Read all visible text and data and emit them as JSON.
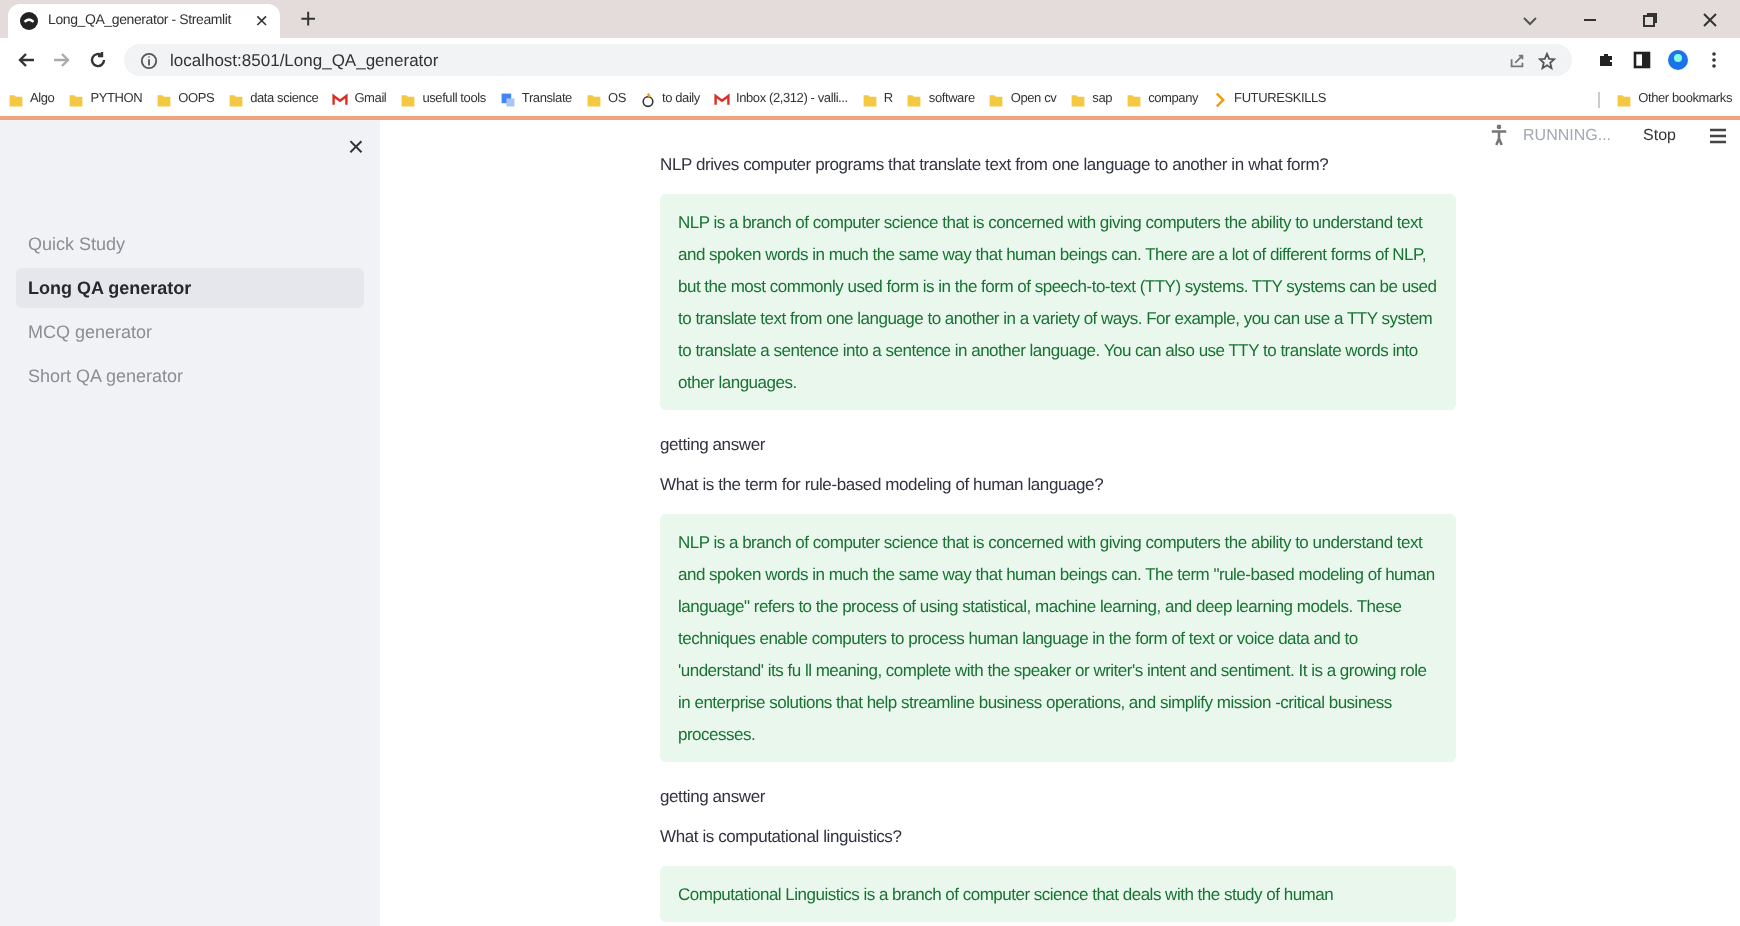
{
  "browser": {
    "tab": {
      "title": "Long_QA_generator - Streamlit",
      "close": "×"
    },
    "new_tab": "+",
    "address": "localhost:8501/Long_QA_generator",
    "bookmarks": [
      {
        "label": "Algo",
        "kind": "folder"
      },
      {
        "label": "PYTHON",
        "kind": "folder"
      },
      {
        "label": "OOPS",
        "kind": "folder"
      },
      {
        "label": "data science",
        "kind": "folder"
      },
      {
        "label": "Gmail",
        "kind": "mail"
      },
      {
        "label": "usefull tools",
        "kind": "folder"
      },
      {
        "label": "Translate",
        "kind": "translate"
      },
      {
        "label": "OS",
        "kind": "folder"
      },
      {
        "label": "to daily",
        "kind": "app"
      },
      {
        "label": "Inbox (2,312) - valli...",
        "kind": "mail"
      },
      {
        "label": "R",
        "kind": "folder"
      },
      {
        "label": "software",
        "kind": "folder"
      },
      {
        "label": "Open cv",
        "kind": "folder"
      },
      {
        "label": "sap",
        "kind": "folder"
      },
      {
        "label": "company",
        "kind": "folder"
      },
      {
        "label": "FUTURESKILLS",
        "kind": "chevron"
      }
    ],
    "other_bookmarks": "Other bookmarks"
  },
  "sidebar": {
    "close": "×",
    "items": [
      {
        "label": "Quick Study",
        "selected": false
      },
      {
        "label": "Long QA generator",
        "selected": true
      },
      {
        "label": "MCQ generator",
        "selected": false
      },
      {
        "label": "Short QA generator",
        "selected": false
      }
    ]
  },
  "header": {
    "status": "RUNNING...",
    "stop": "Stop"
  },
  "blocks": [
    {
      "kind": "question",
      "text": "NLP drives computer programs that translate text from one language to another in what form?"
    },
    {
      "kind": "answer",
      "text": "NLP is a branch of computer science that is concerned with giving computers the ability to understand text and spoken words in much the same way that human beings can. There are a lot of different forms of NLP, but the most commonly used form is in the form of speech-to-text (TTY) systems. TTY systems can be used to translate text from one language to another in a variety of ways. For example, you can use a TTY system to translate a sentence into a sentence in another language. You can also use TTY to translate words into other languages."
    },
    {
      "kind": "status",
      "text": "getting answer"
    },
    {
      "kind": "question",
      "text": "What is the term for rule-based modeling of human language?"
    },
    {
      "kind": "answer",
      "text": "NLP is a branch of computer science that is concerned with giving computers the ability to understand text and spoken words in much the same way that human beings can. The term \"rule-based modeling of human language\" refers to the process of using statistical, machine learning, and deep learning models. These techniques enable computers to process human language in the form of text or voice data and to 'understand' its fu ll meaning, complete with the speaker or   writer's intent and sentiment. It is a growing role in enterprise solutions that help streamline business operations, and simplify mission -critical business processes."
    },
    {
      "kind": "status",
      "text": "getting answer"
    },
    {
      "kind": "question",
      "text": "What is computational linguistics?"
    },
    {
      "kind": "answer",
      "text": "Computational Linguistics is a branch of computer science that deals with the study of human"
    }
  ]
}
